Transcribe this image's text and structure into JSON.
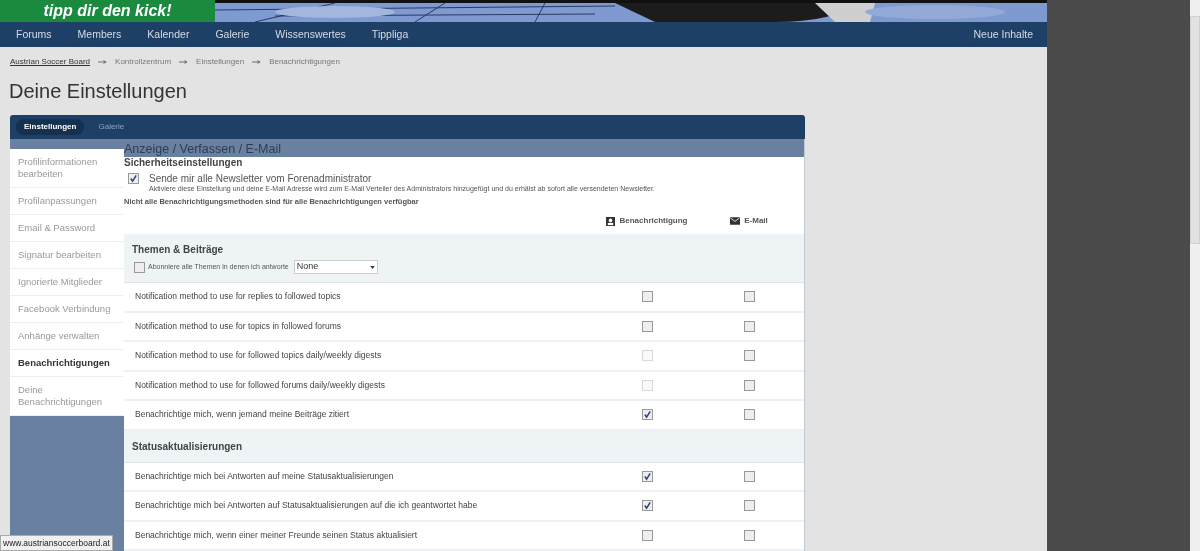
{
  "banner": {
    "slogan": "tipp dir den kick!"
  },
  "nav": {
    "items": [
      "Forums",
      "Members",
      "Kalender",
      "Galerie",
      "Wissenswertes",
      "Tippliga"
    ],
    "right": "Neue Inhalte"
  },
  "breadcrumb": [
    "Austrian Soccer Board",
    "Kontrollzentrum",
    "Einstellungen",
    "Benachrichtigungen"
  ],
  "page_title": "Deine Einstellungen",
  "tabs": [
    {
      "label": "Einstellungen",
      "selected": true
    },
    {
      "label": "Galerie",
      "selected": false
    }
  ],
  "sidebar": {
    "items": [
      {
        "label": "Profilinformationen bearbeiten",
        "selected": false
      },
      {
        "label": "Profilanpassungen",
        "selected": false
      },
      {
        "label": "Email & Password",
        "selected": false
      },
      {
        "label": "Signatur bearbeiten",
        "selected": false
      },
      {
        "label": "Ignorierte Mitglieder",
        "selected": false
      },
      {
        "label": "Facebook Verbindung",
        "selected": false
      },
      {
        "label": "Anhänge verwalten",
        "selected": false
      },
      {
        "label": "Benachrichtigungen",
        "selected": true
      },
      {
        "label": "Deine Benachrichtigungen",
        "selected": false
      }
    ]
  },
  "content": {
    "heading": "Anzeige / Verfassen / E-Mail",
    "security_title": "Sicherheitseinstellungen",
    "newsletter": {
      "checked": true,
      "label": "Sende mir alle Newsletter vom Forenadministrator",
      "hint": "Aktiviere diese Einstellung und deine E-Mail Adresse wird zum E-Mail Verteiler des Administrators hinzugefügt und du erhälst ab sofort alle versendeten Newsletter."
    },
    "note": "Nicht alle Benachrichtigungsmethoden sind für alle Benachrichtigungen verfügbar",
    "columns": [
      {
        "kind": "alert",
        "label": "Benachrichtigung"
      },
      {
        "kind": "email",
        "label": "E-Mail"
      }
    ],
    "sections": [
      {
        "title": "Themen & Beiträge",
        "subscribe": {
          "checked": false,
          "label": "Abonniere alle Themen in denen ich antworte",
          "select_value": "None"
        },
        "rows": [
          {
            "label": "Notification method to use for replies to followed topics",
            "notify_checked": false,
            "notify_disabled": false,
            "email_checked": false
          },
          {
            "label": "Notification method to use for topics in followed forums",
            "notify_checked": false,
            "notify_disabled": false,
            "email_checked": false
          },
          {
            "label": "Notification method to use for followed topics daily/weekly digests",
            "notify_checked": false,
            "notify_disabled": true,
            "email_checked": false
          },
          {
            "label": "Notification method to use for followed forums daily/weekly digests",
            "notify_checked": false,
            "notify_disabled": true,
            "email_checked": false
          },
          {
            "label": "Benachrichtige mich, wenn jemand meine Beiträge zitiert",
            "notify_checked": true,
            "notify_disabled": false,
            "email_checked": false
          }
        ]
      },
      {
        "title": "Statusaktualisierungen",
        "rows": [
          {
            "label": "Benachrichtige mich bei Antworten auf meine Statusaktualisierungen",
            "notify_checked": true,
            "notify_disabled": false,
            "email_checked": false
          },
          {
            "label": "Benachrichtige mich bei Antworten auf Statusaktualisierungen auf die ich geantwortet habe",
            "notify_checked": true,
            "notify_disabled": false,
            "email_checked": false
          },
          {
            "label": "Benachrichtige mich, wenn einer meiner Freunde seinen Status aktualisiert",
            "notify_checked": false,
            "notify_disabled": false,
            "email_checked": false
          }
        ]
      }
    ]
  },
  "status_bar": "www.austriansoccerboard.at"
}
